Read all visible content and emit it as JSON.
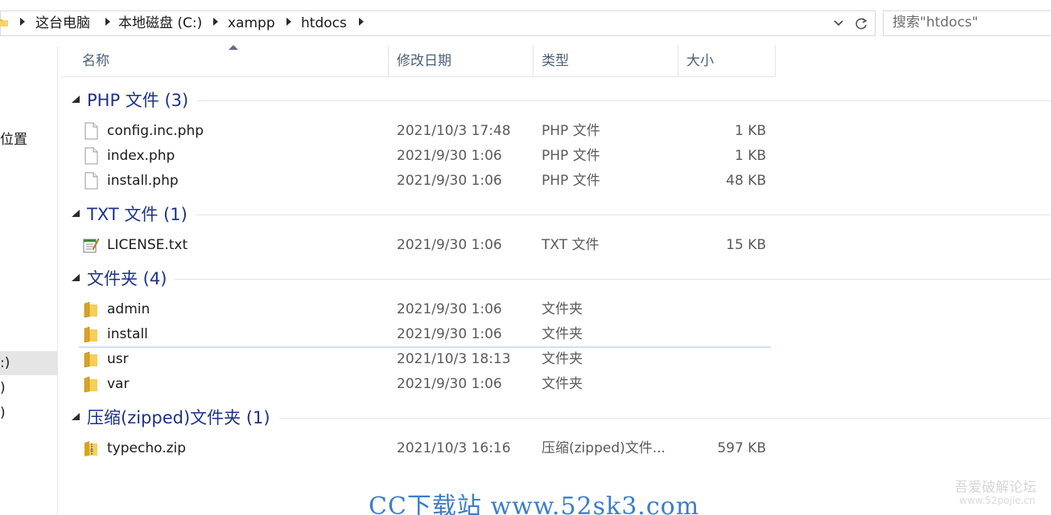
{
  "breadcrumb": [
    "这台电脑",
    "本地磁盘 (C:)",
    "xampp",
    "htdocs"
  ],
  "search": {
    "placeholder": "搜索\"htdocs\""
  },
  "nav": {
    "quick_access_fragment": "位置",
    "drive_fragments": [
      ":)",
      ")",
      ")"
    ]
  },
  "columns": {
    "name": "名称",
    "date": "修改日期",
    "type": "类型",
    "size": "大小"
  },
  "groups": [
    {
      "title": "PHP 文件 (3)",
      "items": [
        {
          "name": "config.inc.php",
          "date": "2021/10/3 17:48",
          "type": "PHP 文件",
          "size": "1 KB",
          "icon": "file-icon"
        },
        {
          "name": "index.php",
          "date": "2021/9/30 1:06",
          "type": "PHP 文件",
          "size": "1 KB",
          "icon": "file-icon"
        },
        {
          "name": "install.php",
          "date": "2021/9/30 1:06",
          "type": "PHP 文件",
          "size": "48 KB",
          "icon": "file-icon"
        }
      ]
    },
    {
      "title": "TXT 文件 (1)",
      "items": [
        {
          "name": "LICENSE.txt",
          "date": "2021/9/30 1:06",
          "type": "TXT 文件",
          "size": "15 KB",
          "icon": "text-document-icon"
        }
      ]
    },
    {
      "title": "文件夹 (4)",
      "items": [
        {
          "name": "admin",
          "date": "2021/9/30 1:06",
          "type": "文件夹",
          "size": "",
          "icon": "folder-icon"
        },
        {
          "name": "install",
          "date": "2021/9/30 1:06",
          "type": "文件夹",
          "size": "",
          "icon": "folder-icon"
        },
        {
          "name": "usr",
          "date": "2021/10/3 18:13",
          "type": "文件夹",
          "size": "",
          "icon": "folder-icon"
        },
        {
          "name": "var",
          "date": "2021/9/30 1:06",
          "type": "文件夹",
          "size": "",
          "icon": "folder-icon"
        }
      ]
    },
    {
      "title": "压缩(zipped)文件夹 (1)",
      "items": [
        {
          "name": "typecho.zip",
          "date": "2021/10/3 16:16",
          "type": "压缩(zipped)文件...",
          "size": "597 KB",
          "icon": "zip-folder-icon"
        }
      ]
    }
  ],
  "watermarks": {
    "main": "CC下载站 www.52sk3.com",
    "corner": "吾爱破解论坛",
    "corner_sub": "www.52pojie.cn"
  },
  "colors": {
    "group_title": "#1e3287",
    "header_text": "#4c607a",
    "watermark": "#3b7ccc"
  }
}
